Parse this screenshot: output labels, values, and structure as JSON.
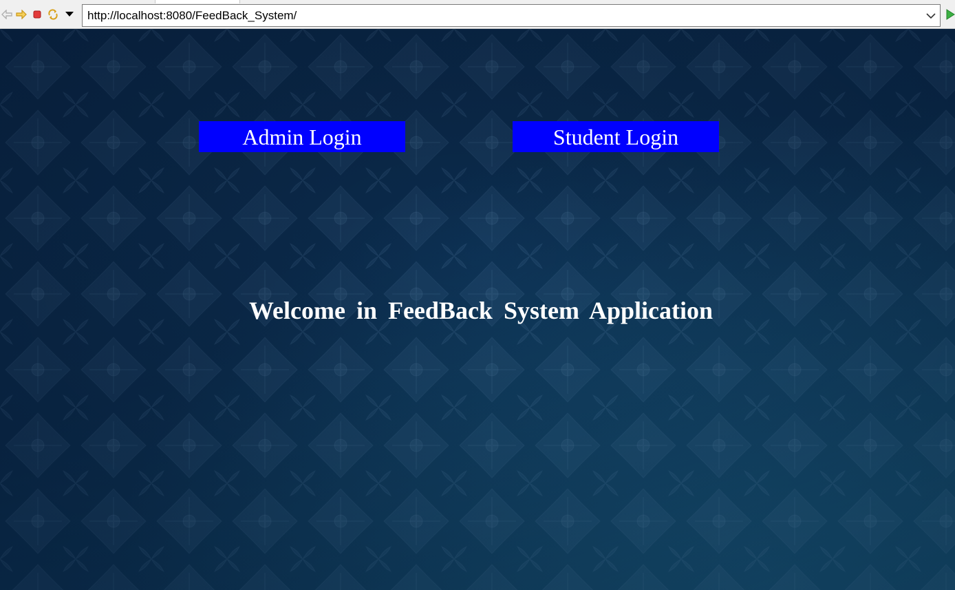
{
  "browser": {
    "url": "http://localhost:8080/FeedBack_System/",
    "icons": {
      "back": "back-arrow-icon",
      "forward": "forward-arrow-icon",
      "stop": "stop-icon",
      "refresh": "refresh-icon",
      "menu": "dropdown-triangle-icon",
      "url_dropdown": "chevron-down-icon",
      "go": "go-play-icon"
    }
  },
  "page": {
    "admin_login_label": "Admin Login",
    "student_login_label": "Student Login",
    "welcome_text": "Welcome in FeedBack System Application"
  },
  "colors": {
    "button_bg": "#0000ff",
    "button_text": "#ffffff",
    "background_dark": "#0a2748",
    "background_light": "#13506e"
  }
}
